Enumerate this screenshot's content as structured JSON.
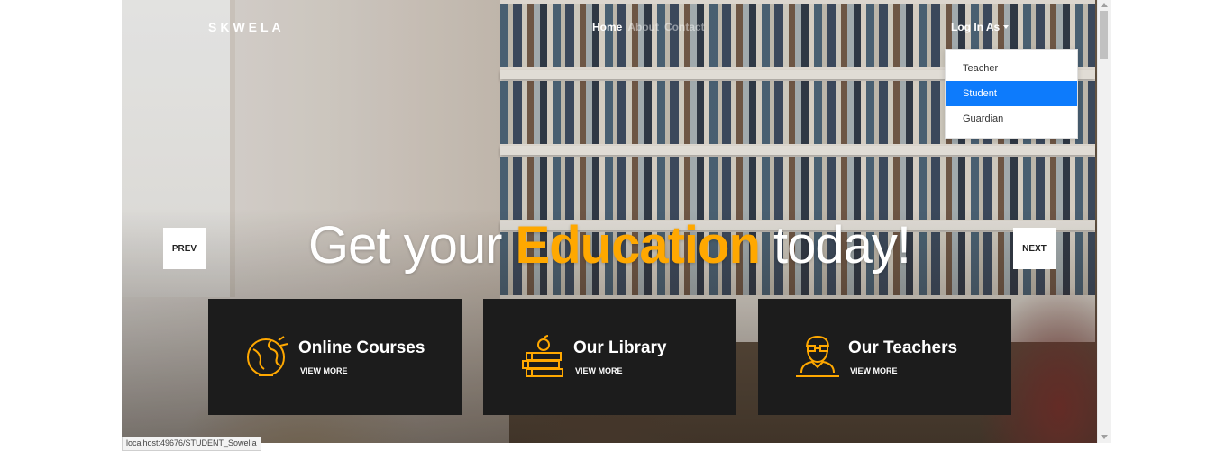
{
  "nav": {
    "brand": "SKWELA",
    "links": [
      "Home",
      "About",
      "Contact"
    ],
    "login_label": "Log In As"
  },
  "dropdown": {
    "items": [
      "Teacher",
      "Student",
      "Guardian"
    ],
    "active": "Student"
  },
  "hero": {
    "headline_pre": "Get your ",
    "headline_highlight": "Education",
    "headline_post": " today!",
    "prev_label": "PREV",
    "next_label": "NEXT"
  },
  "cards": [
    {
      "title": "Online Courses",
      "link": "VIEW MORE",
      "icon": "globe-icon"
    },
    {
      "title": "Our Library",
      "link": "VIEW MORE",
      "icon": "books-apple-icon"
    },
    {
      "title": "Our Teachers",
      "link": "VIEW MORE",
      "icon": "teacher-icon"
    }
  ],
  "status_bar": {
    "url": "localhost:49676/STUDENT_Sowella"
  },
  "colors": {
    "accent": "#ffa800",
    "card_bg": "#1c1c1c",
    "dropdown_active": "#0d7bfc"
  }
}
